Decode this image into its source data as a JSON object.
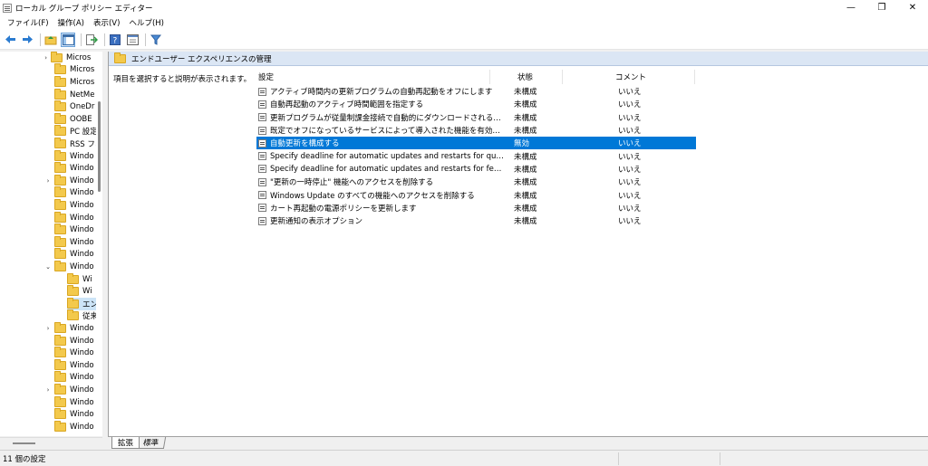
{
  "window": {
    "title": "ローカル グループ ポリシー エディター",
    "minimize": "—",
    "maximize": "❐",
    "close": "✕"
  },
  "menu": [
    {
      "label": "ファイル(F)"
    },
    {
      "label": "操作(A)"
    },
    {
      "label": "表示(V)"
    },
    {
      "label": "ヘルプ(H)"
    }
  ],
  "toolbar": {
    "icons": [
      "back-arrow-icon",
      "forward-arrow-icon",
      "up-folder-icon",
      "console-tree-icon",
      "export-list-icon",
      "help-icon",
      "extended-view-icon",
      "filter-icon"
    ]
  },
  "tree": {
    "items": [
      {
        "label": "Micros",
        "expander": "›"
      },
      {
        "label": "Micros",
        "expander": ""
      },
      {
        "label": "Micros",
        "expander": ""
      },
      {
        "label": "NetMe",
        "expander": ""
      },
      {
        "label": "OneDr",
        "expander": ""
      },
      {
        "label": "OOBE",
        "expander": ""
      },
      {
        "label": "PC 設定",
        "expander": ""
      },
      {
        "label": "RSS フィ",
        "expander": ""
      },
      {
        "label": "Windo",
        "expander": ""
      },
      {
        "label": "Windo",
        "expander": ""
      },
      {
        "label": "Windo",
        "expander": "›"
      },
      {
        "label": "Windo",
        "expander": ""
      },
      {
        "label": "Windo",
        "expander": ""
      },
      {
        "label": "Windo",
        "expander": ""
      },
      {
        "label": "Windo",
        "expander": ""
      },
      {
        "label": "Windo",
        "expander": ""
      },
      {
        "label": "Windo",
        "expander": ""
      },
      {
        "label": "Windo",
        "expander": "⌄"
      },
      {
        "label": "Wi",
        "expander": ""
      },
      {
        "label": "Wi",
        "expander": ""
      },
      {
        "label": "エン",
        "expander": ""
      },
      {
        "label": "従来",
        "expander": ""
      },
      {
        "label": "Windo",
        "expander": "›"
      },
      {
        "label": "Windo",
        "expander": ""
      },
      {
        "label": "Windo",
        "expander": ""
      },
      {
        "label": "Windo",
        "expander": ""
      },
      {
        "label": "Windo",
        "expander": ""
      },
      {
        "label": "Windo",
        "expander": "›"
      },
      {
        "label": "Windo",
        "expander": ""
      },
      {
        "label": "Windo",
        "expander": ""
      },
      {
        "label": "Windo",
        "expander": ""
      }
    ]
  },
  "content": {
    "header": "エンドユーザー エクスペリエンスの管理",
    "description": "項目を選択すると説明が表示されます。",
    "columns": {
      "setting": "設定",
      "state": "状態",
      "comment": "コメント"
    },
    "rows": [
      {
        "name": "アクティブ時間内の更新プログラムの自動再起動をオフにします",
        "state": "未構成",
        "comment": "いいえ"
      },
      {
        "name": "自動再起動のアクティブ時間範囲を指定する",
        "state": "未構成",
        "comment": "いいえ"
      },
      {
        "name": "更新プログラムが従量制課金接続で自動的にダウンロードされるのを許可する",
        "state": "未構成",
        "comment": "いいえ"
      },
      {
        "name": "既定でオフになっているサービスによって導入された機能を有効にする",
        "state": "未構成",
        "comment": "いいえ"
      },
      {
        "name": "自動更新を構成する",
        "state": "無効",
        "comment": "いいえ"
      },
      {
        "name": "Specify deadline for automatic updates and restarts for quality updates",
        "state": "未構成",
        "comment": "いいえ"
      },
      {
        "name": "Specify deadline for automatic updates and restarts for feature updates",
        "state": "未構成",
        "comment": "いいえ"
      },
      {
        "name": "\"更新の一時停止\" 機能へのアクセスを削除する",
        "state": "未構成",
        "comment": "いいえ"
      },
      {
        "name": "Windows Update のすべての機能へのアクセスを削除する",
        "state": "未構成",
        "comment": "いいえ"
      },
      {
        "name": "カート再起動の電源ポリシーを更新します",
        "state": "未構成",
        "comment": "いいえ"
      },
      {
        "name": "更新通知の表示オプション",
        "state": "未構成",
        "comment": "いいえ"
      }
    ]
  },
  "tabs": [
    {
      "label": "拡張"
    },
    {
      "label": "標準"
    }
  ],
  "status": {
    "text": "11 個の設定"
  }
}
